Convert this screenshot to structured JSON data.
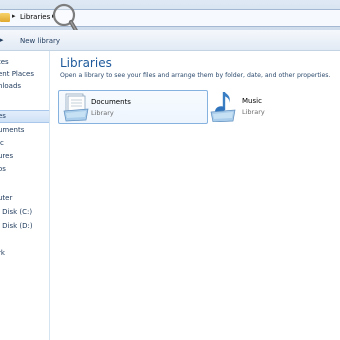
{
  "address": {
    "crumbs": [
      "Libraries"
    ],
    "arrow_glyph": "▸"
  },
  "toolbar": {
    "new_library": "New library",
    "overflow_glyph": "▸"
  },
  "nav": {
    "items": [
      {
        "label": "tes",
        "selected": false
      },
      {
        "label": "ent Places",
        "selected": false
      },
      {
        "label": "nloads",
        "selected": false
      },
      {
        "label": "es",
        "selected": true
      },
      {
        "label": "uments",
        "selected": false
      },
      {
        "label": "ic",
        "selected": false
      },
      {
        "label": "ures",
        "selected": false
      },
      {
        "label": "os",
        "selected": false
      },
      {
        "label": "uter",
        "selected": false
      },
      {
        "label": "l Disk (C:)",
        "selected": false
      },
      {
        "label": "l Disk (D:)",
        "selected": false
      },
      {
        "label": "rk",
        "selected": false
      }
    ]
  },
  "main": {
    "title": "Libraries",
    "subtitle": "Open a library to see your files and arrange them by folder, date, and other properties.",
    "libraries": [
      {
        "name": "Documents",
        "type": "Library",
        "icon": "documents-library-icon"
      },
      {
        "name": "Music",
        "type": "Library",
        "icon": "music-library-icon"
      }
    ]
  },
  "colors": {
    "title_blue": "#1e5a9c",
    "selection": "#cfe1f6",
    "accent_border": "#86b2e0"
  }
}
